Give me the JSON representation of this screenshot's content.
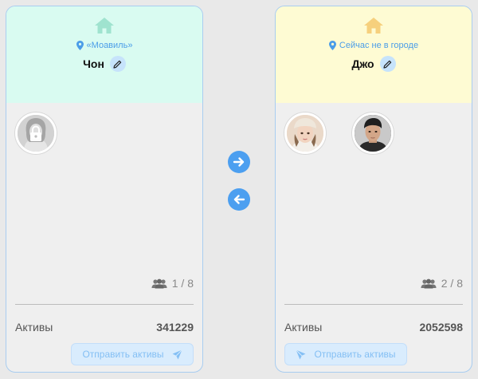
{
  "left_card": {
    "location": "«Моавиль»",
    "name": "Чон",
    "member_count": "1 / 8",
    "assets_label": "Активы",
    "assets_value": "341229",
    "send_label": "Отправить активы",
    "accent": "#9fe3cf",
    "header_bg": "#d9fbf1"
  },
  "right_card": {
    "location": "Сейчас не в городе",
    "name": "Джо",
    "member_count": "2 / 8",
    "assets_label": "Активы",
    "assets_value": "2052598",
    "send_label": "Отправить активы",
    "accent": "#f6d07d",
    "header_bg": "#fefbd3"
  },
  "transfer": {
    "right_icon": "arrow-right-circle-icon",
    "left_icon": "arrow-left-circle-icon"
  }
}
